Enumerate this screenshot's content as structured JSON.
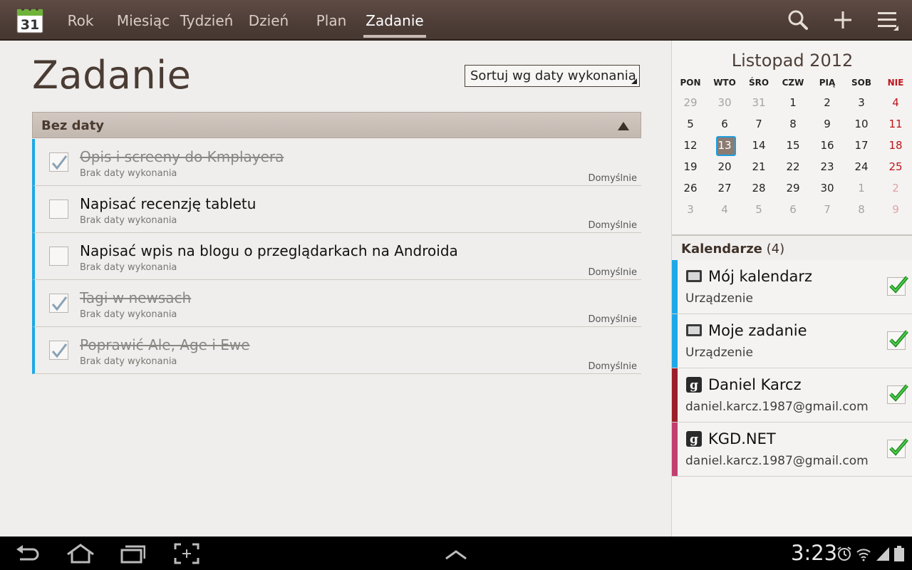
{
  "app": {
    "icon_day": "31",
    "nav_tabs": [
      "Rok",
      "Miesiąc",
      "Tydzień",
      "Dzień",
      "Plan",
      "Zadanie"
    ],
    "active_tab": "Zadanie",
    "icons": [
      "search-icon",
      "add-icon",
      "menu-icon"
    ]
  },
  "main": {
    "title": "Zadanie",
    "sort_label": "Sortuj wg daty wykonania",
    "group_label": "Bez daty",
    "tasks": [
      {
        "title": "Opis i screeny do Kmplayera",
        "subtitle": "Brak daty wykonania",
        "priority": "Domyślnie",
        "done": true
      },
      {
        "title": "Napisać recenzję tabletu",
        "subtitle": "Brak daty wykonania",
        "priority": "Domyślnie",
        "done": false
      },
      {
        "title": "Napisać wpis na blogu o przeglądarkach na Androida",
        "subtitle": "Brak daty wykonania",
        "priority": "Domyślnie",
        "done": false
      },
      {
        "title": "Tagi w newsach",
        "subtitle": "Brak daty wykonania",
        "priority": "Domyślnie",
        "done": true
      },
      {
        "title": "Poprawić Ale, Age i Ewe",
        "subtitle": "Brak daty wykonania",
        "priority": "Domyślnie",
        "done": true
      }
    ],
    "accent_color": "#1ea8e8"
  },
  "mini_calendar": {
    "month_label": "Listopad 2012",
    "weekdays": [
      "PON",
      "WTO",
      "ŚRO",
      "CZW",
      "PIĄ",
      "SOB",
      "NIE"
    ],
    "weeks": [
      [
        "29",
        "30",
        "31",
        "1",
        "2",
        "3",
        "4"
      ],
      [
        "5",
        "6",
        "7",
        "8",
        "9",
        "10",
        "11"
      ],
      [
        "12",
        "13",
        "14",
        "15",
        "16",
        "17",
        "18"
      ],
      [
        "19",
        "20",
        "21",
        "22",
        "23",
        "24",
        "25"
      ],
      [
        "26",
        "27",
        "28",
        "29",
        "30",
        "1",
        "2"
      ],
      [
        "3",
        "4",
        "5",
        "6",
        "7",
        "8",
        "9"
      ]
    ],
    "today": "13",
    "sunday_color": "#c0141c"
  },
  "calendars": {
    "header_label": "Kalendarze",
    "count": "(4)",
    "items": [
      {
        "name": "Mój kalendarz",
        "account": "Urządzenie",
        "color": "#1ea8e8",
        "icon": "device-icon",
        "checked": true
      },
      {
        "name": "Moje zadanie",
        "account": "Urządzenie",
        "color": "#1ea8e8",
        "icon": "device-icon",
        "checked": true
      },
      {
        "name": "Daniel Karcz",
        "account": "daniel.karcz.1987@gmail.com",
        "color": "#9b1f2a",
        "icon": "google-icon",
        "checked": true
      },
      {
        "name": "KGD.NET",
        "account": "daniel.karcz.1987@gmail.com",
        "color": "#c2406f",
        "icon": "google-icon",
        "checked": true
      }
    ]
  },
  "system_bar": {
    "time": "3:23",
    "icons": [
      "back-icon",
      "home-icon",
      "recent-apps-icon",
      "screenshot-icon",
      "up-chevron-icon",
      "alarm-icon",
      "wifi-icon",
      "signal-icon",
      "battery-icon"
    ]
  }
}
